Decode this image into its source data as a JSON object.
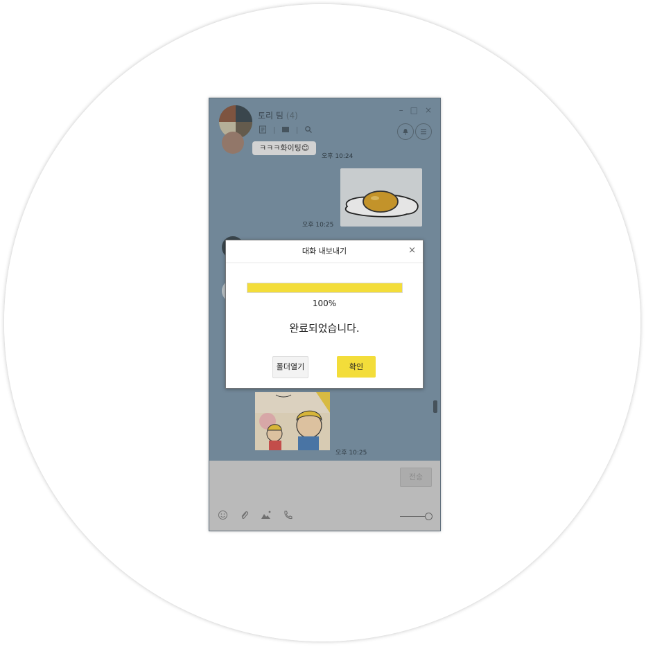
{
  "chat": {
    "title": "토리 팀",
    "member_count": "(4)",
    "window_controls": [
      "–",
      "□",
      "×"
    ],
    "messages": [
      {
        "text": "ㅋㅋㅋ화이팅😊",
        "time": "오후 10:24"
      },
      {
        "time": "오후 10:25"
      },
      {
        "time": "오후 10:25"
      }
    ],
    "send_label": "전송"
  },
  "dialog": {
    "title": "대화 내보내기",
    "close": "×",
    "progress": 1.0,
    "percent": "100%",
    "message": "완료되었습니다.",
    "open_folder": "폴더열기",
    "confirm": "확인"
  },
  "colors": {
    "chat_bg": "#7c95a8",
    "accent_yellow": "#f3dd3a"
  }
}
